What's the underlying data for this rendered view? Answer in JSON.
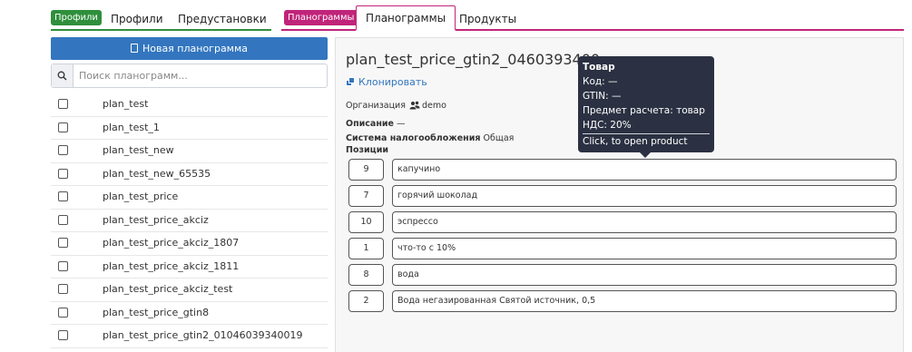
{
  "tabs": {
    "profiles_badge": "Профили",
    "profiles": "Профили",
    "presets": "Предустановки",
    "planograms_badge": "Планограммы",
    "planograms": "Планограммы",
    "products": "Продукты"
  },
  "sidebar": {
    "new_button": "Новая планограмма",
    "search_placeholder": "Поиск планограмм...",
    "items": [
      "plan_test",
      "plan_test_1",
      "plan_test_new",
      "plan_test_new_65535",
      "plan_test_price",
      "plan_test_price_akciz",
      "plan_test_price_akciz_1807",
      "plan_test_price_akciz_1811",
      "plan_test_price_akciz_test",
      "plan_test_price_gtin8",
      "plan_test_price_gtin2_01046039340019"
    ]
  },
  "detail": {
    "title": "plan_test_price_gtin2_0460393400",
    "clone": "Клонировать",
    "org_label": "Организация",
    "org_value": "demo",
    "desc_label": "Описание",
    "desc_value": "—",
    "tax_label": "Система налогообложения",
    "tax_value": "Общая",
    "positions_label": "Позиции",
    "positions": [
      {
        "qty": "9",
        "name": "капучино"
      },
      {
        "qty": "7",
        "name": "горячий шоколад"
      },
      {
        "qty": "10",
        "name": "эспрессо"
      },
      {
        "qty": "1",
        "name": "что-то с 10%"
      },
      {
        "qty": "8",
        "name": "вода"
      },
      {
        "qty": "2",
        "name": "Вода негазированная Святой источник, 0,5"
      }
    ]
  },
  "tooltip": {
    "title": "Товар",
    "code": "Код: —",
    "gtin": "GTIN: —",
    "subject": "Предмет расчета: товар",
    "vat": "НДС: 20%",
    "hint": "Click, to open product"
  },
  "colors": {
    "green": "#2f8f3c",
    "pink": "#c0247a",
    "primary": "#3376bf",
    "tooltip_bg": "#2b3142"
  }
}
